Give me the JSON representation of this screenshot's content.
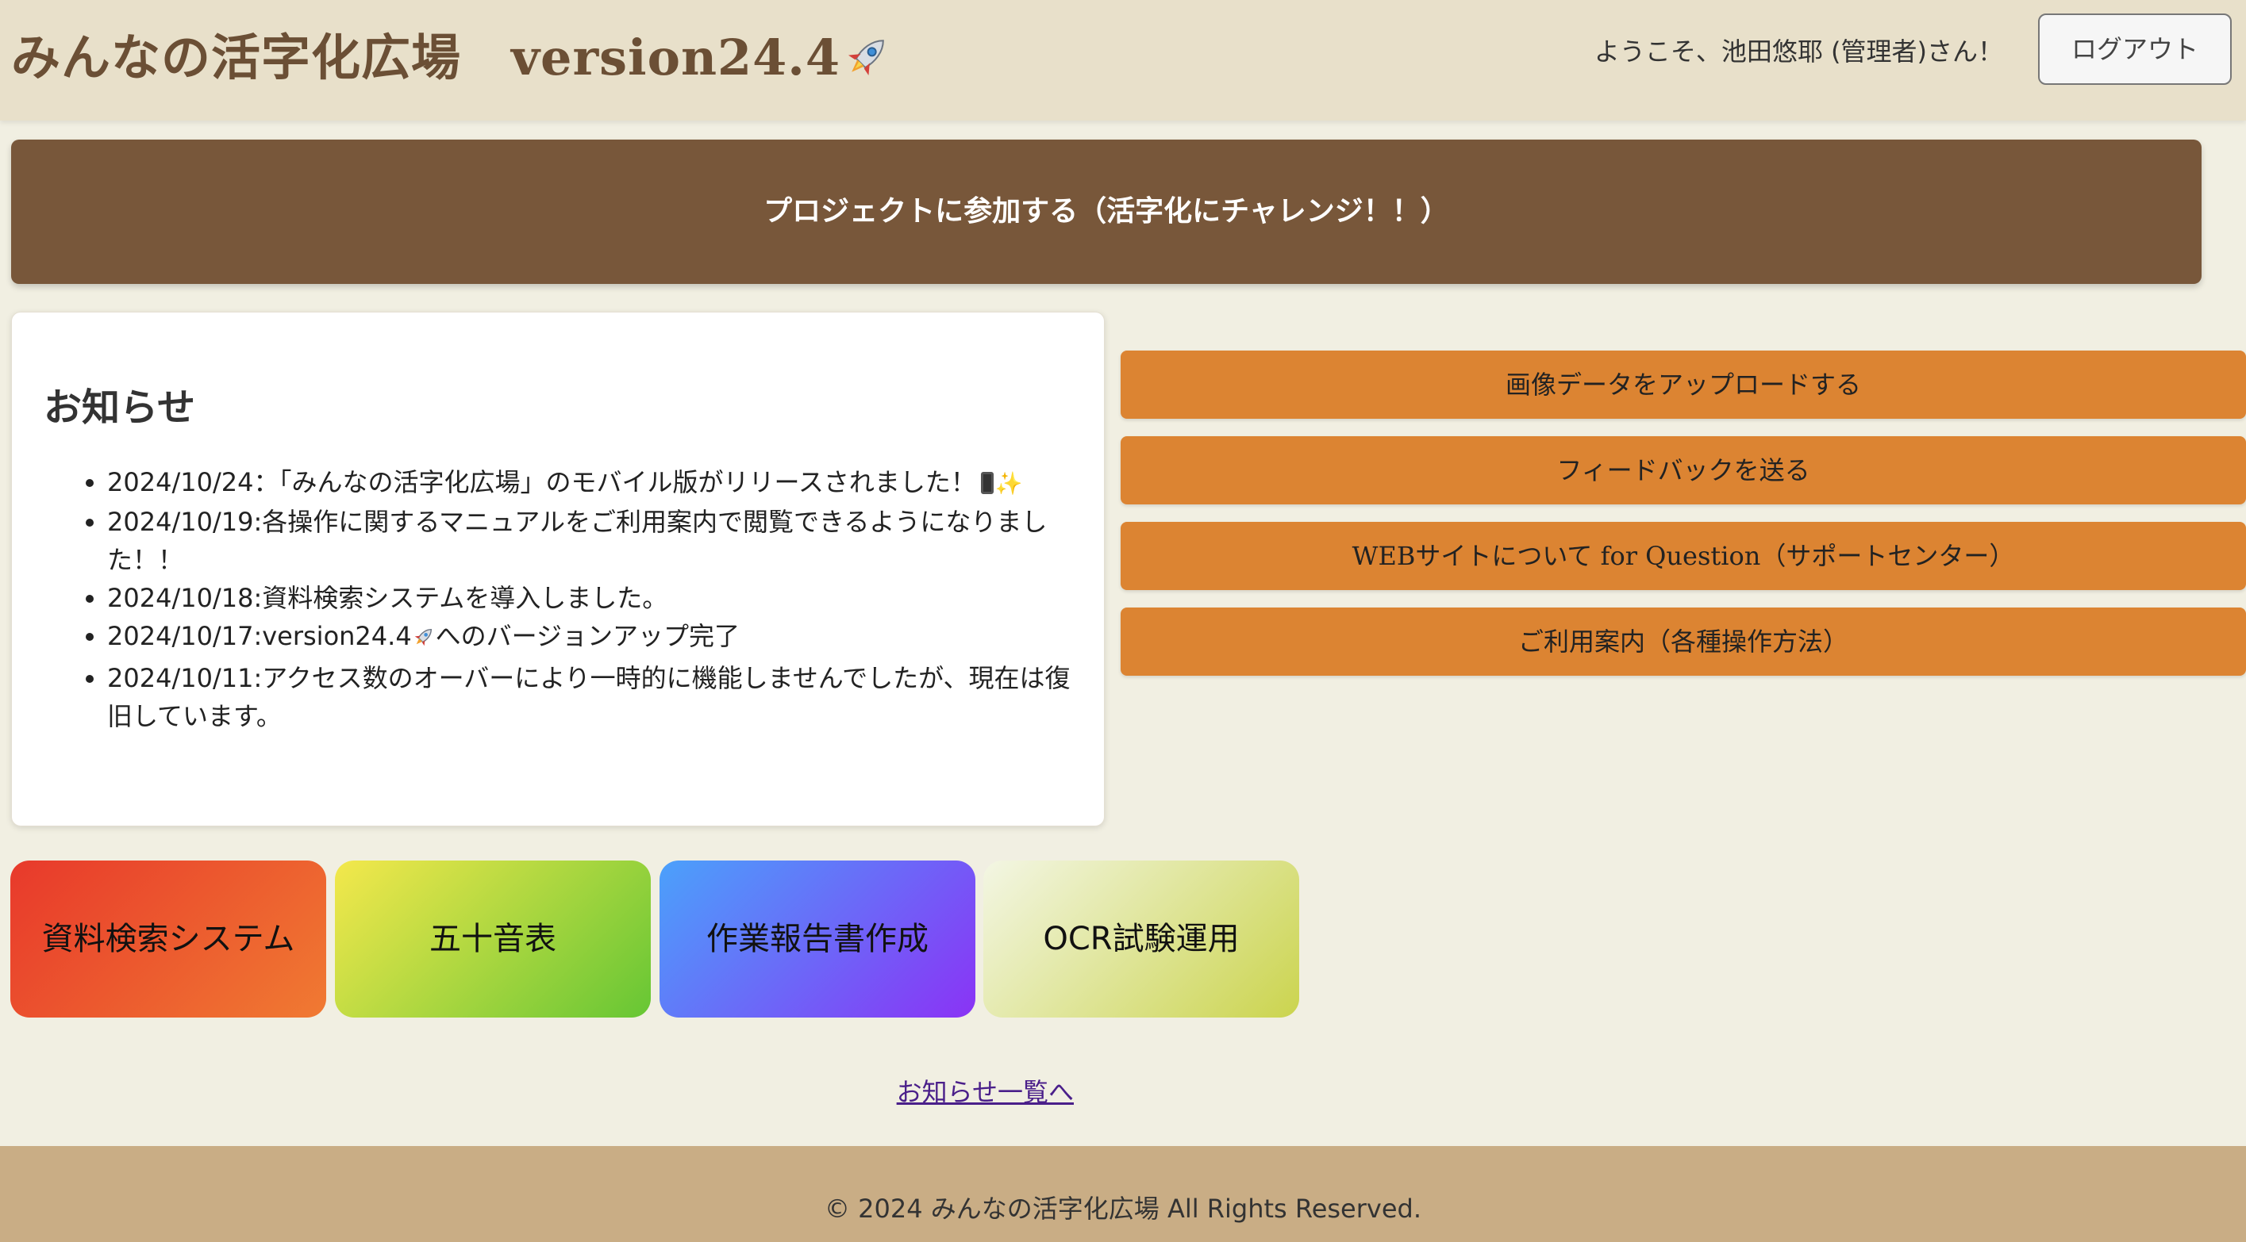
{
  "header": {
    "title": "みんなの活字化広場　version24.4",
    "title_emoji": "rocket-icon",
    "welcome": "ようこそ、池田悠耶 (管理者)さん！",
    "logout_label": "ログアウト"
  },
  "banner": {
    "join_label": "プロジェクトに参加する（活字化にチャレンジ！！）"
  },
  "news": {
    "title": "お知らせ",
    "items": [
      "2024/10/24：「みんなの活字化広場」のモバイル版がリリースされました！",
      "2024/10/19:各操作に関するマニュアルをご利用案内で閲覧できるようになりました！！",
      "2024/10/18:資料検索システムを導入しました。",
      "2024/10/17:version24.4",
      "へのバージョンアップ完了",
      "2024/10/11:アクセス数のオーバーにより一時的に機能しませんでしたが、現在は復旧しています。"
    ],
    "more_link": "お知らせ一覧へ"
  },
  "actions": {
    "upload": "画像データをアップロードする",
    "feedback": "フィードバックを送る",
    "support": "WEBサイトについて for Question（サポートセンター）",
    "guide": "ご利用案内（各種操作方法）"
  },
  "tiles": {
    "search": "資料検索システム",
    "gojuon": "五十音表",
    "report": "作業報告書作成",
    "ocr": "OCR試験運用"
  },
  "footer": {
    "copyright": "© 2024 みんなの活字化広場 All Rights Reserved."
  },
  "colors": {
    "header_bg": "#e8e0ca",
    "banner_bg": "#78573a",
    "action_bg": "#dc8432",
    "footer_bg": "#c9ad85",
    "page_bg": "#f1efe2"
  }
}
